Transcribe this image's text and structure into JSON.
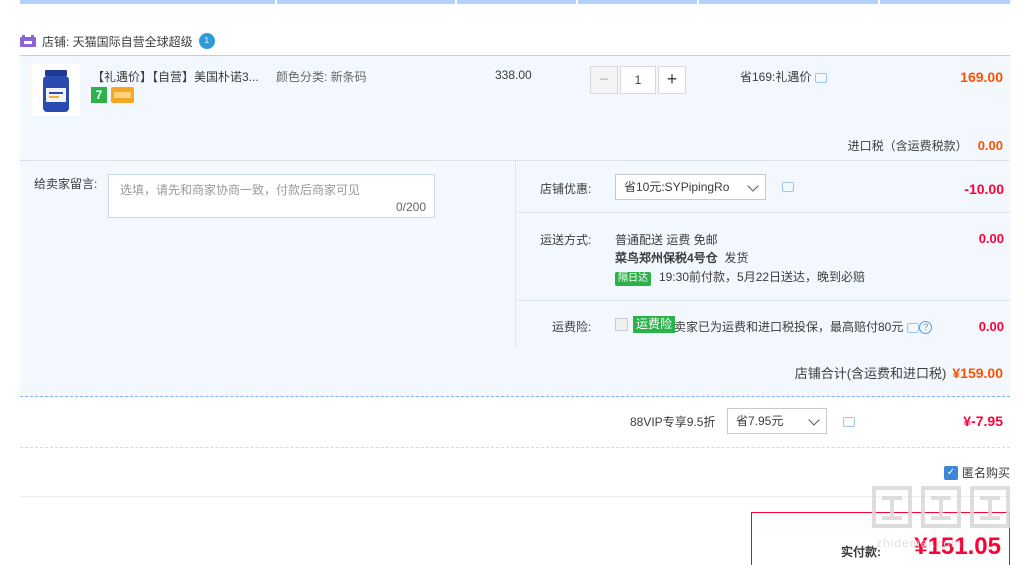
{
  "shop": {
    "label": "店铺: 天猫国际自营全球超级",
    "badge": "1"
  },
  "item": {
    "title": "【礼遇价】【自营】美国朴诺3...",
    "tag_num": "7",
    "sku": "颜色分类: 新条码",
    "unit_price": "338.00",
    "qty_minus": "−",
    "qty": "1",
    "qty_plus": "+",
    "save_text": "省169:礼遇价",
    "total": "169.00"
  },
  "tax": {
    "label": "进口税（含运费税款）",
    "value": "0.00"
  },
  "message": {
    "label": "给卖家留言:",
    "placeholder": "选填，请先和商家协商一致，付款后商家可见",
    "counter": "0/200"
  },
  "shop_discount": {
    "label": "店铺优惠:",
    "selected": "省10元:SYPipingRo",
    "value": "-10.00"
  },
  "shipping": {
    "label": "运送方式:",
    "line1": "普通配送 运费 免邮",
    "warehouse": "菜鸟郑州保税4号仓",
    "dispatch": "发货",
    "badge": "隔日达",
    "eta": "19:30前付款，5月22日送达，晚到必赔",
    "value": "0.00"
  },
  "insurance": {
    "label": "运费险:",
    "badge": "运费险",
    "text": "卖家已为运费和进口税投保，最高赔付80元",
    "help": "?",
    "value": "0.00"
  },
  "shop_total": {
    "label": "店铺合计(含运费和进口税)",
    "value": "¥159.00"
  },
  "vip": {
    "label": "88VIP专享9.5折",
    "selected": "省7.95元",
    "value": "¥-7.95"
  },
  "anonymous": {
    "check": "✓",
    "label": "匿名购买"
  },
  "payment": {
    "label": "实付款:",
    "value": "¥151.05"
  },
  "watermark": {
    "sub": "zhidemai.com"
  },
  "colors": {
    "accent_orange": "#ff5000",
    "accent_red": "#ff0036",
    "panel_bg": "#f3f8fe",
    "green": "#2bb34a",
    "blue": "#3e87d7"
  }
}
